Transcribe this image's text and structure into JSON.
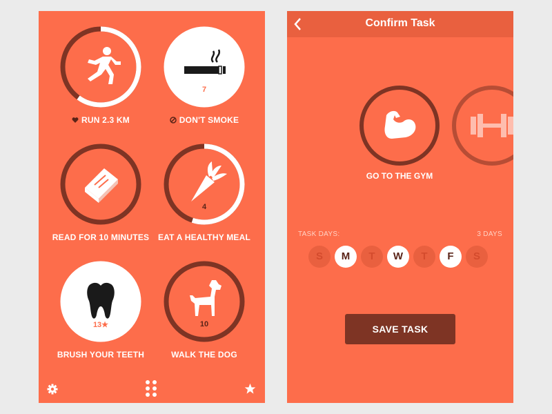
{
  "habits": [
    {
      "label": "RUN 2.3 KM",
      "label_icon": "heart-icon",
      "count": "",
      "icon": "runner-icon",
      "progress": 0.6,
      "filled": false
    },
    {
      "label": "DON'T SMOKE",
      "label_icon": "no-icon",
      "count": "7",
      "icon": "cigarette-icon",
      "progress": 1.0,
      "filled": true
    },
    {
      "label": "READ FOR 10 MINUTES",
      "count": "",
      "icon": "book-icon",
      "progress": 0.0,
      "filled": false
    },
    {
      "label": "EAT A HEALTHY MEAL",
      "count": "4",
      "icon": "carrot-icon",
      "progress": 0.55,
      "filled": false
    },
    {
      "label": "BRUSH YOUR TEETH",
      "count": "13★",
      "icon": "tooth-icon",
      "progress": 1.0,
      "filled": true
    },
    {
      "label": "WALK THE DOG",
      "count": "10",
      "icon": "dog-icon",
      "progress": 0.0,
      "filled": false
    }
  ],
  "bottom_bar": {
    "left_icon": "gear-icon",
    "center_icon": "grid-dots-icon",
    "right_icon": "star-icon"
  },
  "confirm": {
    "title": "Confirm Task",
    "task_label": "GO TO THE GYM",
    "task_icon": "flexed-arm-icon",
    "next_icon": "dumbbell-icon",
    "task_days_label": "TASK DAYS:",
    "days_count": "3 DAYS",
    "days": [
      {
        "letter": "S",
        "selected": false
      },
      {
        "letter": "M",
        "selected": true
      },
      {
        "letter": "T",
        "selected": false
      },
      {
        "letter": "W",
        "selected": true
      },
      {
        "letter": "T",
        "selected": false
      },
      {
        "letter": "F",
        "selected": true
      },
      {
        "letter": "S",
        "selected": false
      }
    ],
    "save_label": "SAVE TASK"
  },
  "colors": {
    "background": "#fd6d4b",
    "dark": "#5a2418",
    "ring_track": "#7e3424",
    "white": "#ffffff"
  }
}
